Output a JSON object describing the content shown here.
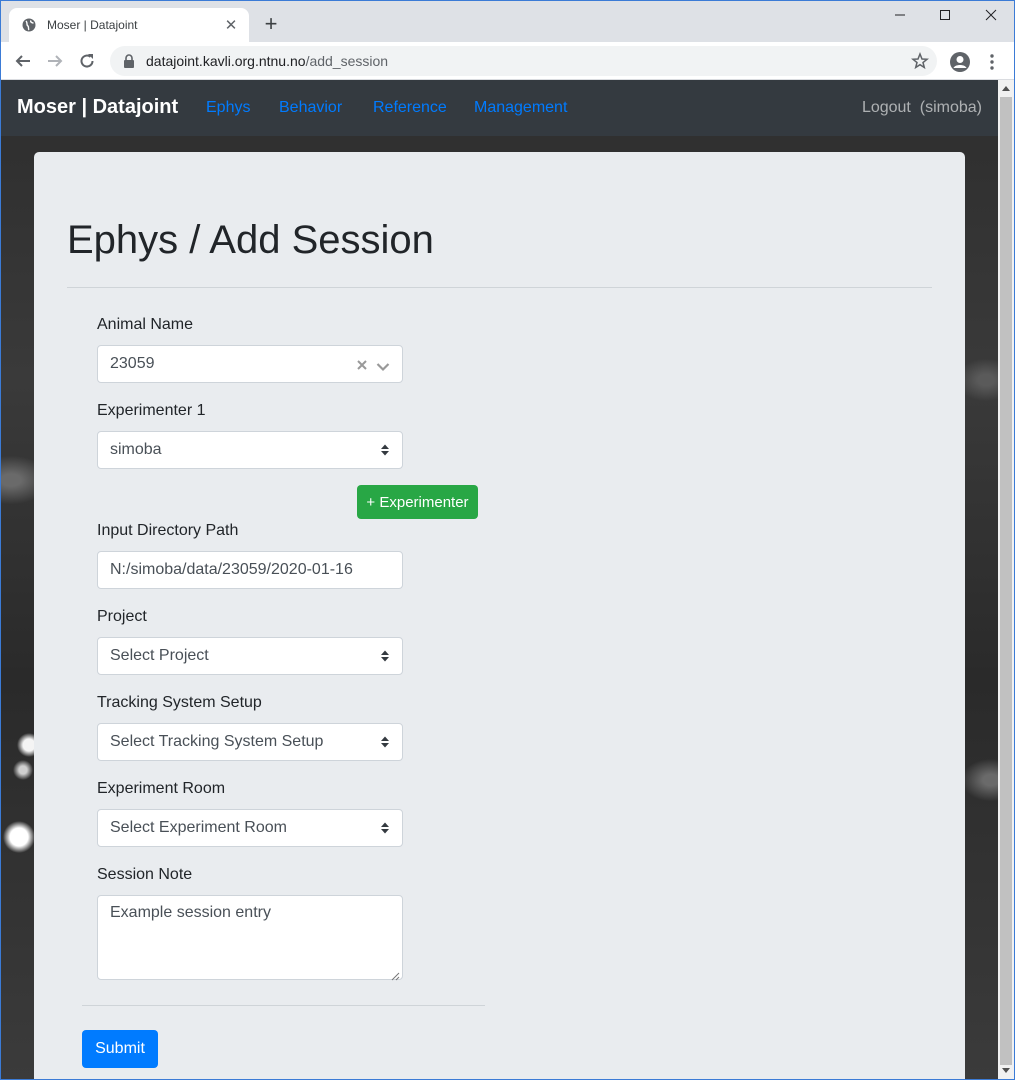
{
  "browser": {
    "tab_title": "Moser | Datajoint",
    "url_host": "datajoint.kavli.org.ntnu.no",
    "url_path": "/add_session",
    "new_tab_label": "+"
  },
  "navbar": {
    "brand": "Moser | Datajoint",
    "links": [
      "Ephys",
      "Behavior",
      "Reference",
      "Management"
    ],
    "logout": "Logout  (simoba)"
  },
  "page": {
    "title": "Ephys / Add Session"
  },
  "form": {
    "animal_name": {
      "label": "Animal Name",
      "value": "23059"
    },
    "experimenter_1": {
      "label": "Experimenter 1",
      "value": "simoba"
    },
    "add_experimenter_button": "+ Experimenter",
    "input_directory": {
      "label": "Input Directory Path",
      "value": "N:/simoba/data/23059/2020-01-16"
    },
    "project": {
      "label": "Project",
      "value": "Select Project"
    },
    "tracking_system_setup": {
      "label": "Tracking System Setup",
      "value": "Select Tracking System Setup"
    },
    "experiment_room": {
      "label": "Experiment Room",
      "value": "Select Experiment Room"
    },
    "session_note": {
      "label": "Session Note",
      "value": "Example session entry"
    },
    "submit_button": "Submit"
  },
  "colors": {
    "navbar_bg": "#343a40",
    "link": "#007bff",
    "success": "#28a745",
    "primary": "#007bff",
    "card_bg": "#e9ecef"
  }
}
